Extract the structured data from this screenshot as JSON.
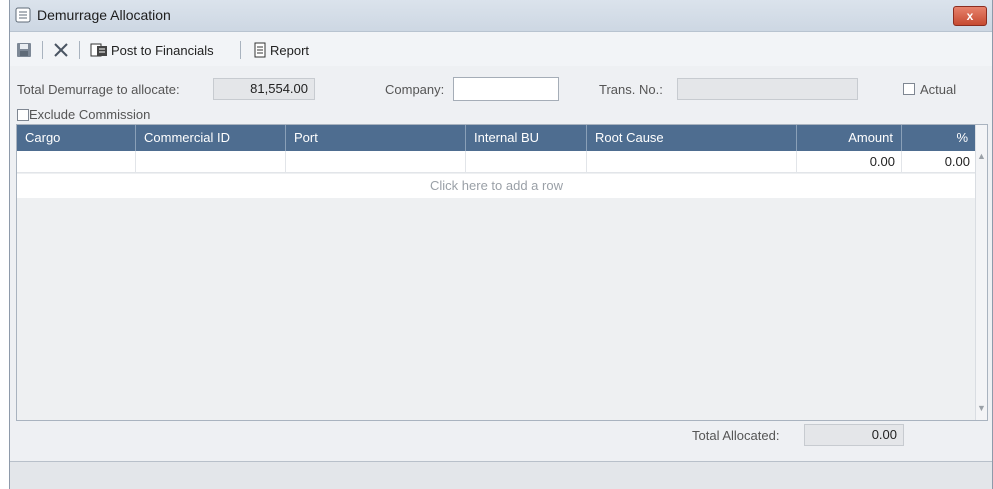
{
  "window": {
    "title": "Demurrage Allocation",
    "close_glyph": "x"
  },
  "toolbar": {
    "post_label": "Post to Financials",
    "report_label": "Report"
  },
  "form": {
    "total_label": "Total Demurrage to allocate:",
    "total_value": "81,554.00",
    "company_label": "Company:",
    "company_value": "",
    "trans_label": "Trans. No.:",
    "trans_value": "",
    "actual_label": "Actual",
    "actual_checked": false,
    "exclude_label": "Exclude Commission",
    "exclude_checked": false
  },
  "grid": {
    "columns": [
      "Cargo",
      "Commercial ID",
      "Port",
      "Internal BU",
      "Root Cause",
      "Amount",
      "%"
    ],
    "rows": [
      {
        "cargo": "",
        "commercial_id": "",
        "port": "",
        "internal_bu": "",
        "root_cause": "",
        "amount": "0.00",
        "pct": "0.00"
      }
    ],
    "add_row_text": "Click here to add a row"
  },
  "footer": {
    "total_allocated_label": "Total Allocated:",
    "total_allocated_value": "0.00"
  },
  "colors": {
    "header_bg": "#4e6d90",
    "close_bg": "#c64a31"
  },
  "icons": [
    "document-list-icon",
    "save-icon",
    "delete-x-icon",
    "post-financials-icon",
    "report-icon",
    "close-icon"
  ]
}
